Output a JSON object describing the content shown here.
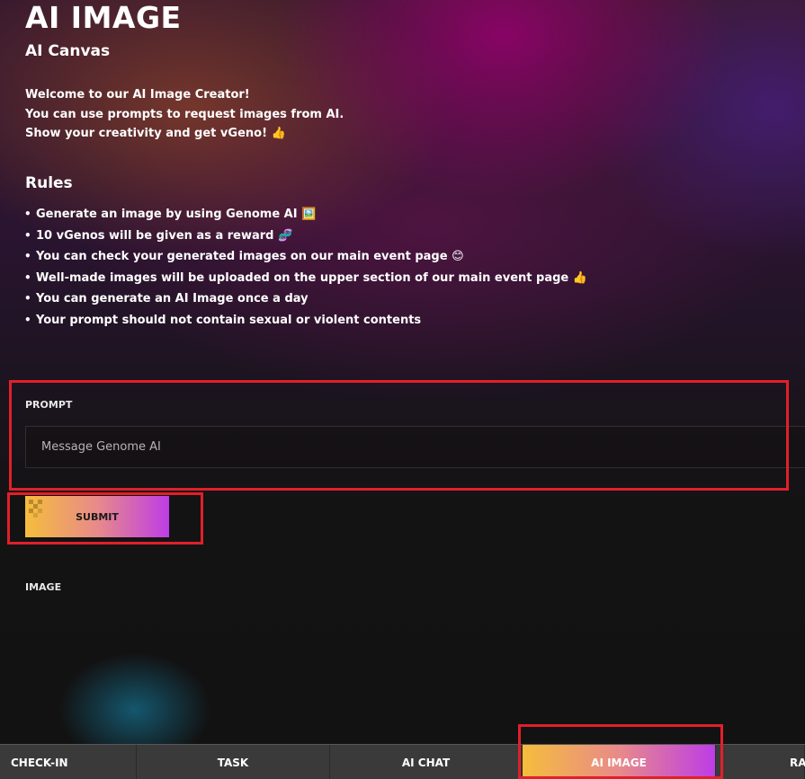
{
  "header": {
    "title": "AI IMAGE",
    "subtitle": "AI Canvas"
  },
  "intro": {
    "lines": [
      "Welcome to our AI Image Creator!",
      "You can use prompts to request images from AI.",
      "Show your creativity and get vGeno! 👍"
    ]
  },
  "rules": {
    "heading": "Rules",
    "bullet": "•",
    "items": [
      "Generate an image by using Genome AI 🖼️",
      "10 vGenos will be given as a reward 🧬",
      "You can check your generated images on our main event page 😊",
      "Well-made images will be uploaded on the upper section of our main event page 👍",
      "You can generate an AI Image once a day",
      "Your prompt should not contain sexual or violent contents"
    ]
  },
  "prompt": {
    "label": "PROMPT",
    "placeholder": "Message Genome AI",
    "value": ""
  },
  "submit": {
    "label": "SUBMIT"
  },
  "image": {
    "label": "IMAGE"
  },
  "bottom_nav": {
    "tabs": [
      {
        "label": "CHECK-IN",
        "active": false
      },
      {
        "label": "TASK",
        "active": false
      },
      {
        "label": "AI CHAT",
        "active": false
      },
      {
        "label": "AI IMAGE",
        "active": true
      },
      {
        "label": "RA",
        "active": false
      }
    ]
  },
  "colors": {
    "highlight": "#e0202a",
    "accent_start": "#f5bd3c",
    "accent_mid": "#e88a8a",
    "accent_end": "#bd3de6",
    "nav_background": "#3a3a3a"
  }
}
